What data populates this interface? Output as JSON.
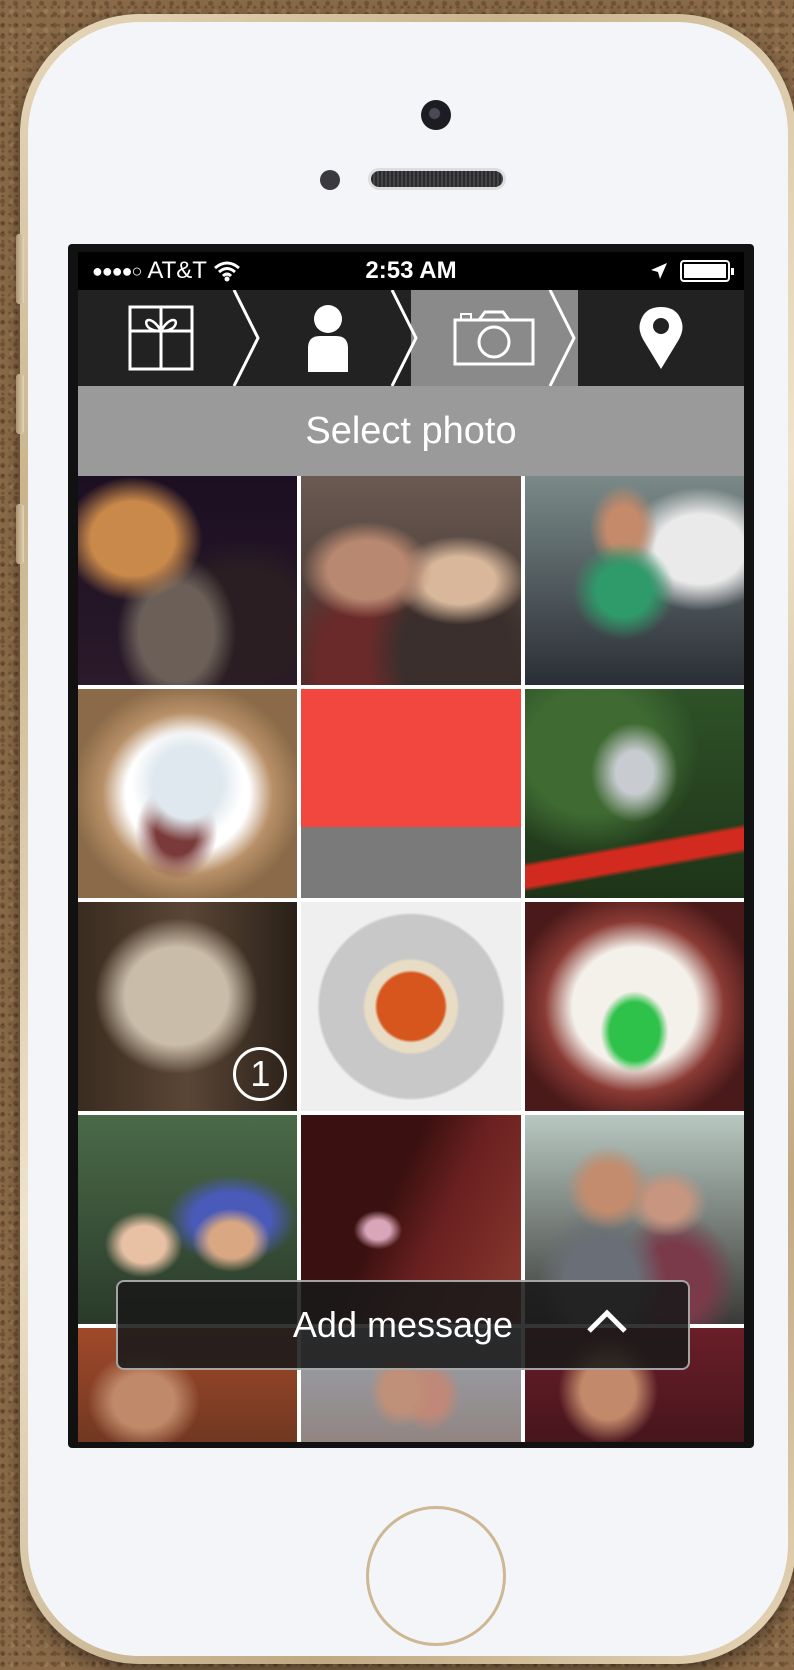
{
  "status": {
    "signal": "●●●●○",
    "carrier": "AT&T",
    "time": "2:53 AM"
  },
  "steps": [
    {
      "icon": "gift-icon",
      "active": false
    },
    {
      "icon": "person-icon",
      "active": false
    },
    {
      "icon": "camera-icon",
      "active": true
    },
    {
      "icon": "location-pin-icon",
      "active": false
    }
  ],
  "subheader": "Select photo",
  "photos": [
    {
      "badge": ""
    },
    {
      "badge": ""
    },
    {
      "badge": ""
    },
    {
      "badge": ""
    },
    {
      "badge": ""
    },
    {
      "badge": ""
    },
    {
      "badge": "1"
    },
    {
      "badge": ""
    },
    {
      "badge": ""
    },
    {
      "badge": ""
    },
    {
      "badge": ""
    },
    {
      "badge": ""
    }
  ],
  "message_bar": {
    "label": "Add message",
    "icon": "chevron-up-icon"
  },
  "colors": {
    "active_step": "#8a8a8a",
    "step_bar": "#222222",
    "subheader": "#9a9a9a"
  }
}
